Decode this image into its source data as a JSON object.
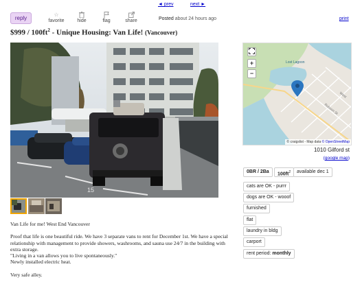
{
  "nav": {
    "prev": "◄ prev",
    "next": "next ►"
  },
  "actions": {
    "reply": "reply",
    "favorite": "favorite",
    "hide": "hide",
    "flag": "flag",
    "share": "share"
  },
  "posted": {
    "label": "Posted",
    "ago": "about 24 hours ago"
  },
  "print": "print",
  "title": {
    "price": "$999",
    "size_prefix": " / 100ft",
    "size_sup": "2",
    "text": " - Unique Housing: Van Life! ",
    "location": "(Vancouver)"
  },
  "map": {
    "labels": {
      "lagoon": "Lost Lagoon",
      "robson": "Robson St",
      "west": "West"
    },
    "attribution_prefix": "© craigslist - Map data ",
    "attribution_link": "© OpenStreetMap"
  },
  "address": "1010 Gilford st",
  "google_map": {
    "open": "(",
    "link": "google map",
    "close": ")"
  },
  "attrgroup": {
    "br_ba": "0BR / 2Ba",
    "sqft": "100ft",
    "sqft_sup": "2",
    "available": "available dec 1",
    "cats": "cats are OK - purrr",
    "dogs": "dogs are OK - wooof",
    "furnished": "furnished",
    "flat": "flat",
    "laundry": "laundry in bldg",
    "carport": "carport",
    "rent_label": "rent period: ",
    "rent_value": "monthly"
  },
  "body": {
    "line1": "Van Life for me! West End Vancouver",
    "para2": "Proof that life is one beautiful ride. We have 3 separate vans to rent for December 1st. We have a special relationship with management to provide showers, washrooms, and sauna use 24/7 in the building with extra storage.",
    "quote": "\"Living in a van allows you to live spontaneously.\"",
    "heat": "Newly installed electric heat.",
    "alley": "Very safe alley."
  },
  "colors": {
    "link": "#0000cc",
    "reply_bg": "#ead4f4",
    "reply_text": "#551a8b",
    "map_water": "#aad3df",
    "map_park": "#c8dfb4",
    "map_pin": "#2b76c0"
  }
}
